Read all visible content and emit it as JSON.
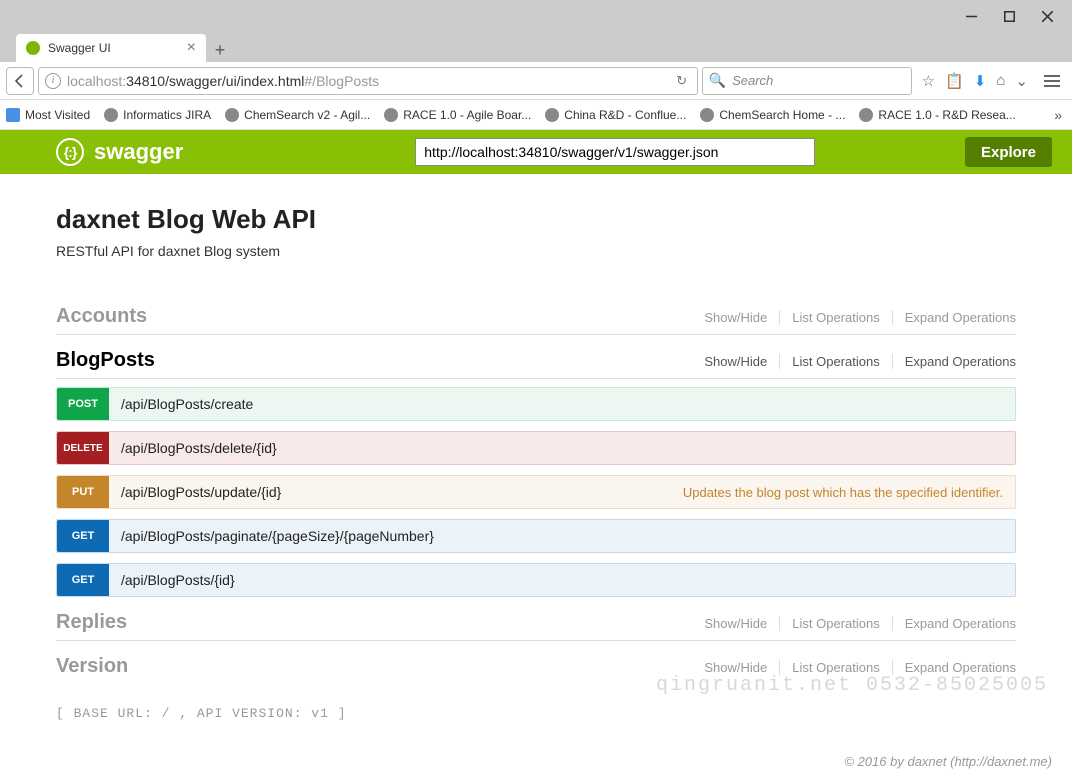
{
  "window": {
    "tab_title": "Swagger UI",
    "url_prefix": "localhost:",
    "url_mid": "34810/swagger/ui/index.html",
    "url_suffix": "#/BlogPosts",
    "search_placeholder": "Search"
  },
  "bookmarks": [
    {
      "label": "Most Visited"
    },
    {
      "label": "Informatics JIRA"
    },
    {
      "label": "ChemSearch v2 - Agil..."
    },
    {
      "label": "RACE 1.0 - Agile Boar..."
    },
    {
      "label": "China R&D - Conflue..."
    },
    {
      "label": "ChemSearch Home - ..."
    },
    {
      "label": "RACE 1.0 - R&D Resea..."
    }
  ],
  "swagger": {
    "logo_text": "swagger",
    "spec_url": "http://localhost:34810/swagger/v1/swagger.json",
    "explore": "Explore"
  },
  "api": {
    "title": "daxnet Blog Web API",
    "description": "RESTful API for daxnet Blog system",
    "base_url_label": "BASE URL",
    "base_url": "/",
    "api_version_label": "API VERSION",
    "api_version": "v1"
  },
  "op_links": {
    "showhide": "Show/Hide",
    "list": "List Operations",
    "expand": "Expand Operations"
  },
  "sections": {
    "accounts": {
      "name": "Accounts"
    },
    "blogposts": {
      "name": "BlogPosts"
    },
    "replies": {
      "name": "Replies"
    },
    "version": {
      "name": "Version"
    }
  },
  "endpoints": [
    {
      "method": "POST",
      "path": "/api/BlogPosts/create",
      "summary": ""
    },
    {
      "method": "DELETE",
      "path": "/api/BlogPosts/delete/{id}",
      "summary": ""
    },
    {
      "method": "PUT",
      "path": "/api/BlogPosts/update/{id}",
      "summary": "Updates the blog post which has the specified identifier."
    },
    {
      "method": "GET",
      "path": "/api/BlogPosts/paginate/{pageSize}/{pageNumber}",
      "summary": ""
    },
    {
      "method": "GET",
      "path": "/api/BlogPosts/{id}",
      "summary": ""
    }
  ],
  "watermark": "qingruanit.net 0532-85025005",
  "footer": "© 2016 by daxnet (http://daxnet.me)"
}
